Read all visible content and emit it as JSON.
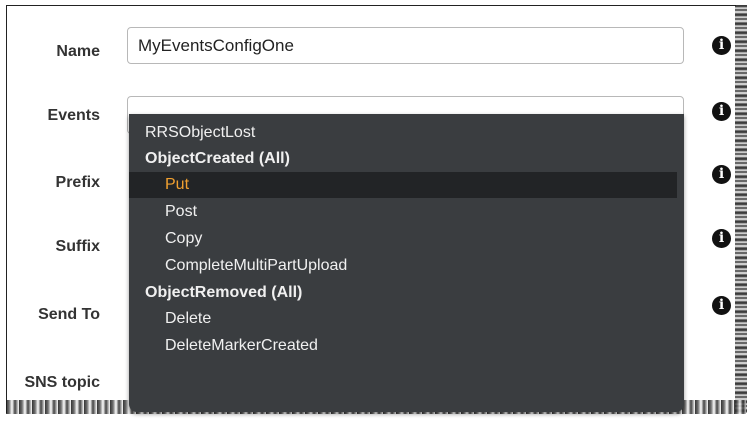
{
  "form": {
    "name_label": "Name",
    "name_value": "MyEventsConfigOne",
    "events_label": "Events",
    "events_value": "",
    "prefix_label": "Prefix",
    "suffix_label": "Suffix",
    "sendto_label": "Send To",
    "snstopic_label": "SNS topic",
    "info_glyph": "i"
  },
  "dropdown": {
    "options": [
      {
        "label": "RRSObjectLost",
        "kind": "plain"
      },
      {
        "label": "ObjectCreated (All)",
        "kind": "group"
      },
      {
        "label": "Put",
        "kind": "sub",
        "selected": true
      },
      {
        "label": "Post",
        "kind": "sub"
      },
      {
        "label": "Copy",
        "kind": "sub"
      },
      {
        "label": "CompleteMultiPartUpload",
        "kind": "sub"
      },
      {
        "label": "ObjectRemoved (All)",
        "kind": "group"
      },
      {
        "label": "Delete",
        "kind": "sub"
      },
      {
        "label": "DeleteMarkerCreated",
        "kind": "sub"
      }
    ]
  },
  "colors": {
    "dropdown_bg": "#3a3d40",
    "selected_bg": "#222426",
    "selected_text": "#f0a030"
  }
}
